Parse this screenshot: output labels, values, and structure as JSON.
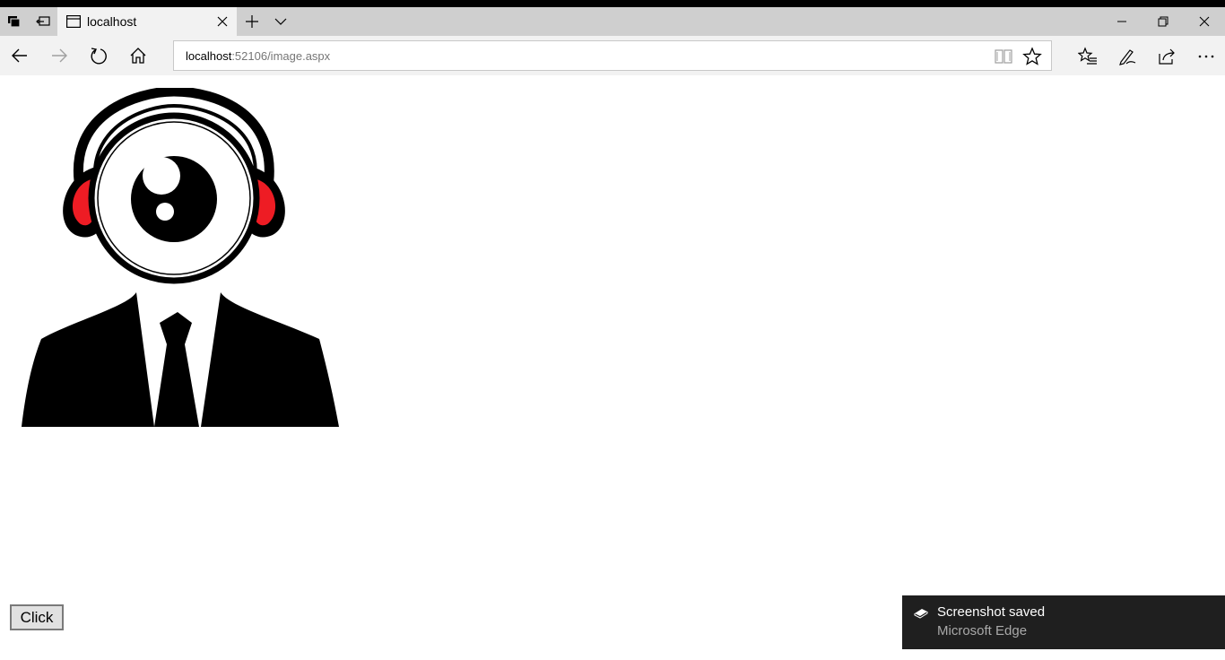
{
  "browser": {
    "tab_title": "localhost",
    "url_host": "localhost",
    "url_rest": ":52106/image.aspx"
  },
  "icons": {
    "tab_left_1": "set-aside-tabs-icon",
    "tab_left_2": "show-set-aside-tabs-icon",
    "favicon": "page-icon",
    "new_tab": "plus-icon",
    "tab_list": "chevron-down-icon",
    "minimize": "minimize-icon",
    "restore": "restore-icon",
    "close": "close-icon",
    "back": "back-arrow-icon",
    "forward": "forward-arrow-icon",
    "refresh": "refresh-icon",
    "home": "home-icon",
    "reading_view": "book-icon",
    "favorite": "star-icon",
    "favorites_hub": "favorites-list-icon",
    "notes": "pen-icon",
    "share": "share-icon",
    "more": "more-icon"
  },
  "page": {
    "image_alt": "",
    "button_label": "Click"
  },
  "toast": {
    "title": "Screenshot saved",
    "subtitle": "Microsoft Edge"
  },
  "colors": {
    "accent_red": "#ee1c24",
    "toast_bg": "#1f1f1f"
  }
}
